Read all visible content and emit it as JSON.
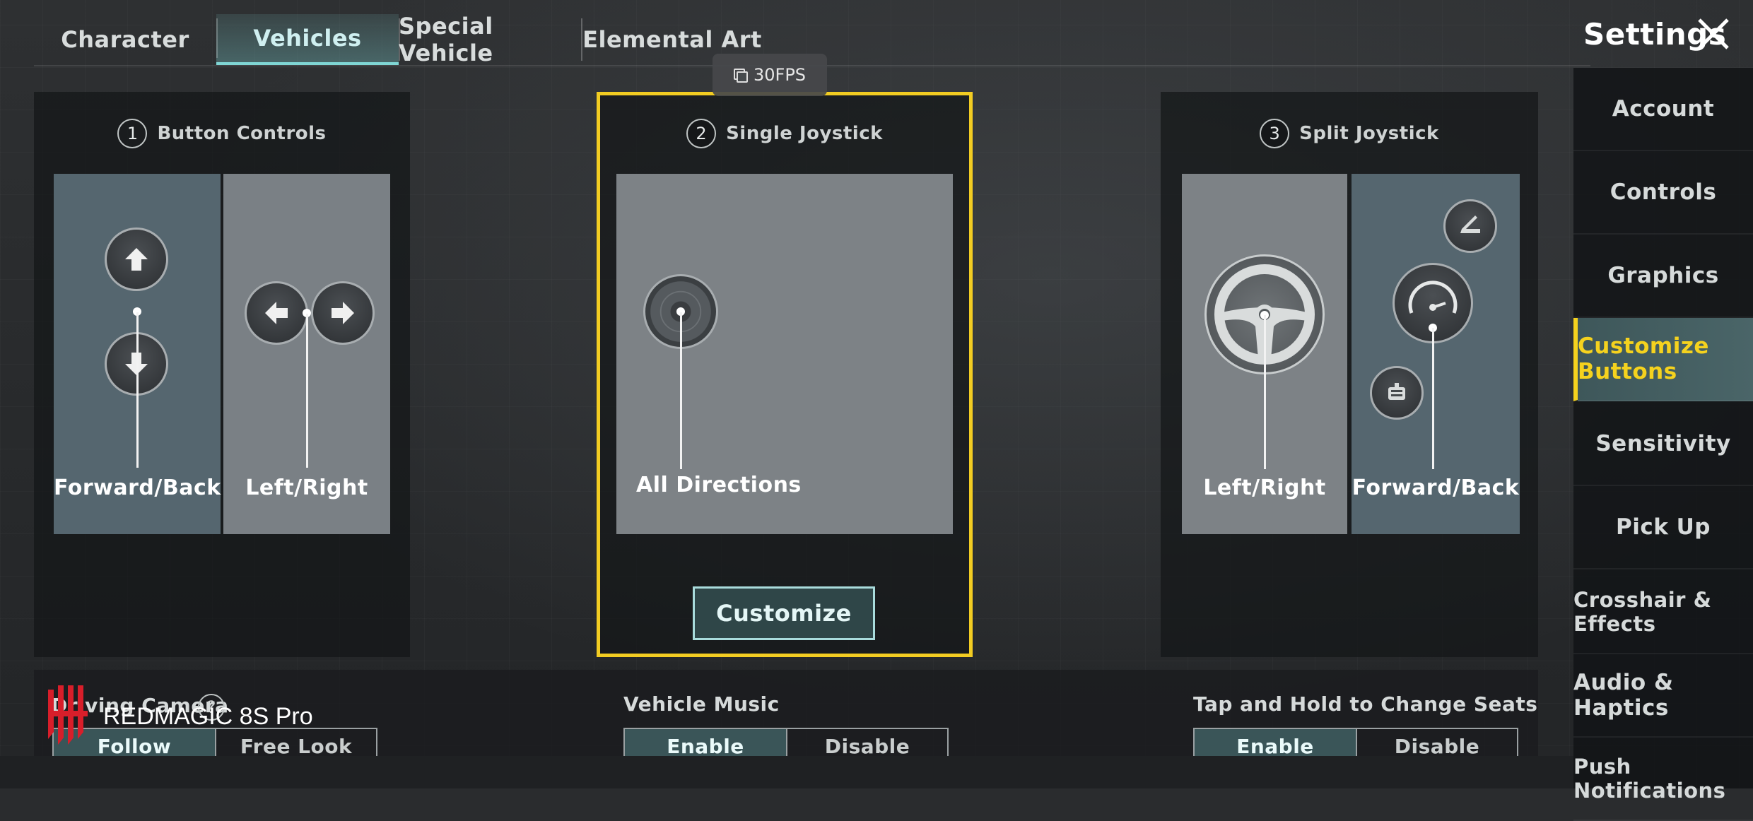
{
  "tabs": [
    {
      "label": "Character"
    },
    {
      "label": "Vehicles"
    },
    {
      "label": "Special Vehicle"
    },
    {
      "label": "Elemental Art"
    }
  ],
  "header": {
    "title": "Settings",
    "close_icon": "close-icon"
  },
  "fps": {
    "label": "30FPS"
  },
  "options": [
    {
      "number": "1",
      "title": "Button Controls",
      "zones": [
        "Forward/Back",
        "Left/Right"
      ]
    },
    {
      "number": "2",
      "title": "Single Joystick",
      "zones": [
        "All Directions"
      ],
      "action": "Customize"
    },
    {
      "number": "3",
      "title": "Split Joystick",
      "zones": [
        "Left/Right",
        "Forward/Back"
      ]
    }
  ],
  "sidebar": {
    "items": [
      {
        "label": "Account"
      },
      {
        "label": "Controls"
      },
      {
        "label": "Graphics"
      },
      {
        "label": "Customize Buttons"
      },
      {
        "label": "Sensitivity"
      },
      {
        "label": "Pick Up"
      },
      {
        "label": "Crosshair & Effects"
      },
      {
        "label": "Audio & Haptics"
      },
      {
        "label": "Push Notifications"
      }
    ]
  },
  "bottom": {
    "driving_camera": {
      "label": "Driving Camera",
      "options": [
        "Follow",
        "Free Look"
      ],
      "help": "?"
    },
    "vehicle_music": {
      "label": "Vehicle Music",
      "options": [
        "Enable",
        "Disable"
      ]
    },
    "change_seats": {
      "label": "Tap and Hold to Change Seats",
      "options": [
        "Enable",
        "Disable"
      ]
    }
  },
  "watermark": {
    "text": "REDMAGIC 8S Pro"
  },
  "colors": {
    "accent": "#f5d21e",
    "tab_active": "#7fd6d4",
    "zone_blue": "#55666f",
    "zone_grey": "#7a8085"
  }
}
